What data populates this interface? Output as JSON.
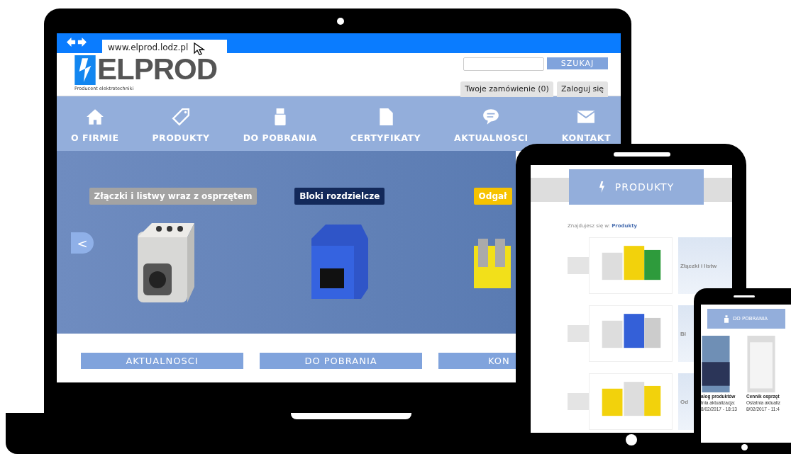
{
  "laptop": {
    "browser": {
      "url": "www.elprod.lodz.pl"
    },
    "logo": {
      "name": "ELPROD",
      "tagline": "Producent elektrotechniki"
    },
    "search": {
      "button": "SZUKAJ"
    },
    "account_tabs": [
      "Twoje zamówienie (0)",
      "Zaloguj się"
    ],
    "nav": [
      "O FIRMIE",
      "PRODUKTY",
      "DO POBRANIA",
      "CERTYFIKATY",
      "AKTUALNOSCI",
      "KONTAKT"
    ],
    "slider": {
      "prev": "<",
      "slides": [
        {
          "title": "Złączki i listwy wraz z osprzętem",
          "color": "#a3a3a3",
          "kind": "connector"
        },
        {
          "title": "Bloki rozdzielcze",
          "color": "#13295a",
          "kind": "block"
        },
        {
          "title": "Odgał",
          "color": "#f6c200",
          "kind": "strip"
        }
      ]
    },
    "buttons": [
      "AKTUALNOSCI",
      "DO POBRANIA",
      "KON"
    ]
  },
  "tablet": {
    "header": "PRODUKTY",
    "breadcrumb": "Znajdujesz się w: **Produkty**",
    "products": [
      "Złączki i listw",
      "Bl",
      "Od"
    ]
  },
  "phone": {
    "header": "DO POBRANIA",
    "files": [
      {
        "title": "alog produktów",
        "updated": "tnia aktualizacja:",
        "date": "8/02/2017 - 18:13"
      },
      {
        "title": "Cennik osprzęt",
        "updated": "Ostatnia aktualiz",
        "date": "8/02/2017 - 11:4"
      }
    ]
  }
}
